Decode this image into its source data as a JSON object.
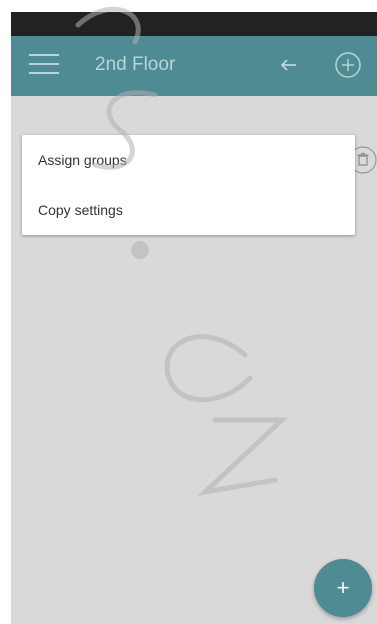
{
  "header": {
    "title": "2nd Floor"
  },
  "popup_menu": {
    "items": [
      {
        "label": "Assign groups"
      },
      {
        "label": "Copy settings"
      }
    ]
  },
  "fab": {
    "symbol": "+"
  },
  "icons": {
    "menu": "menu-icon",
    "back": "arrow-back-icon",
    "add": "add-circle-icon",
    "trash": "trash-icon",
    "fab": "plus-icon"
  },
  "colors": {
    "accent": "#4f8b93",
    "status_bar": "#222222",
    "background": "#d9d9d9",
    "header_text": "#b7d4d8"
  }
}
